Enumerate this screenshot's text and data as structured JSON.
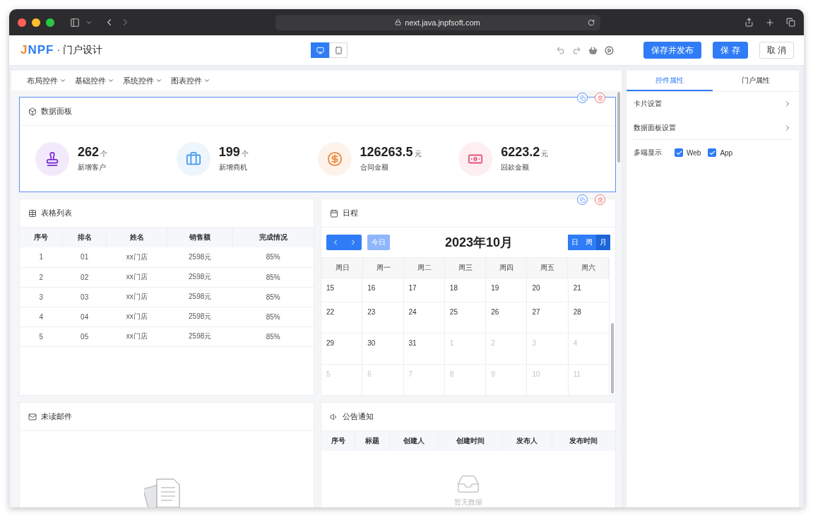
{
  "browser": {
    "url": "next.java.jnpfsoft.com"
  },
  "header": {
    "logo": "JNPF",
    "title": "· 门户设计",
    "devices": [
      {
        "kind": "desktop",
        "selected": true
      },
      {
        "kind": "mobile",
        "selected": false
      }
    ],
    "buttons": [
      {
        "label": "保存并发布",
        "kind": "primary"
      },
      {
        "label": "保 存",
        "kind": "primary"
      },
      {
        "label": "取 消",
        "kind": "default"
      }
    ]
  },
  "menus": [
    "布局控件",
    "基础控件",
    "系统控件",
    "图表控件"
  ],
  "data_panel": {
    "title": "数据面板",
    "selected": true,
    "show_actions": true,
    "stats": [
      {
        "value": "262",
        "unit": "个",
        "label": "新增客户",
        "color": "#7b2fd6"
      },
      {
        "value": "199",
        "unit": "个",
        "label": "新增商机",
        "color": "#4a9bf0"
      },
      {
        "value": "126263.5",
        "unit": "元",
        "label": "合同金额",
        "color": "#ef8a3f"
      },
      {
        "value": "6223.2",
        "unit": "元",
        "label": "回款金额",
        "color": "#e8557a"
      }
    ]
  },
  "table_card": {
    "title": "表格列表",
    "columns": [
      "序号",
      "排名",
      "姓名",
      "销售额",
      "完成情况"
    ],
    "rows": [
      [
        "1",
        "01",
        "xx门店",
        "2598元",
        "85%"
      ],
      [
        "2",
        "02",
        "xx门店",
        "2598元",
        "85%"
      ],
      [
        "3",
        "03",
        "xx门店",
        "2598元",
        "85%"
      ],
      [
        "4",
        "04",
        "xx门店",
        "2598元",
        "85%"
      ],
      [
        "5",
        "05",
        "xx门店",
        "2598元",
        "85%"
      ]
    ]
  },
  "calendar": {
    "title": "日程",
    "show_actions": true,
    "month": "2023年10月",
    "today": {
      "label": "今日",
      "disabled": true
    },
    "views": [
      {
        "label": "日",
        "selected": false
      },
      {
        "label": "周",
        "selected": false
      },
      {
        "label": "月",
        "selected": true
      }
    ],
    "weekdays": [
      "周日",
      "周一",
      "周二",
      "周三",
      "周四",
      "周五",
      "周六"
    ],
    "weeks": [
      [
        {
          "day": "15",
          "other_month": false
        },
        {
          "day": "16",
          "other_month": false
        },
        {
          "day": "17",
          "other_month": false
        },
        {
          "day": "18",
          "other_month": false
        },
        {
          "day": "19",
          "other_month": false
        },
        {
          "day": "20",
          "other_month": false
        },
        {
          "day": "21",
          "other_month": false
        }
      ],
      [
        {
          "day": "22",
          "other_month": false
        },
        {
          "day": "23",
          "other_month": false
        },
        {
          "day": "24",
          "other_month": false
        },
        {
          "day": "25",
          "other_month": false
        },
        {
          "day": "26",
          "other_month": false
        },
        {
          "day": "27",
          "other_month": false
        },
        {
          "day": "28",
          "other_month": false
        }
      ],
      [
        {
          "day": "29",
          "other_month": false
        },
        {
          "day": "30",
          "other_month": false
        },
        {
          "day": "31",
          "other_month": false
        },
        {
          "day": "1",
          "other_month": true
        },
        {
          "day": "2",
          "other_month": true
        },
        {
          "day": "3",
          "other_month": true
        },
        {
          "day": "4",
          "other_month": true
        }
      ],
      [
        {
          "day": "5",
          "other_month": true
        },
        {
          "day": "6",
          "other_month": true
        },
        {
          "day": "7",
          "other_month": true
        },
        {
          "day": "8",
          "other_month": true
        },
        {
          "day": "9",
          "other_month": true
        },
        {
          "day": "10",
          "other_month": true
        },
        {
          "day": "11",
          "other_month": true
        }
      ]
    ]
  },
  "mail_card": {
    "title": "未读邮件"
  },
  "notice_card": {
    "title": "公告通知",
    "columns": [
      "序号",
      "标题",
      "创建人",
      "创建时间",
      "发布人",
      "发布时间"
    ],
    "empty_text": "暂无数据"
  },
  "properties": {
    "tabs": [
      {
        "label": "控件属性",
        "selected": true
      },
      {
        "label": "门户属性",
        "selected": false
      }
    ],
    "rows": [
      {
        "label": "卡片设置"
      },
      {
        "label": "数据面板设置"
      }
    ],
    "display": {
      "label": "多端显示",
      "options": [
        {
          "label": "Web",
          "checked": true
        },
        {
          "label": "App",
          "checked": true
        }
      ]
    }
  }
}
